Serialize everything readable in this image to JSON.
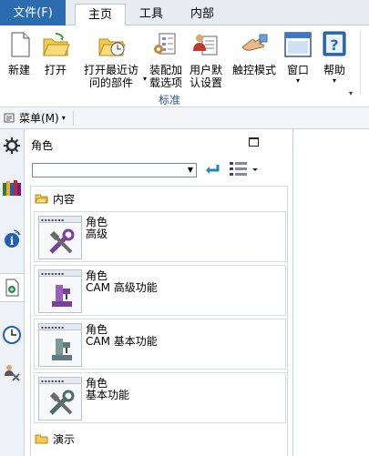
{
  "tabs": {
    "file": "文件(F)",
    "home": "主页",
    "tools": "工具",
    "internal": "内部"
  },
  "ribbon": {
    "buttons": {
      "new": "新建",
      "open": "打开",
      "open_recent_line1": "打开最近访",
      "open_recent_line2": "问的部件",
      "assembly_load_line1": "装配加",
      "assembly_load_line2": "载选项",
      "user_defaults_line1": "用户默",
      "user_defaults_line2": "认设置",
      "touch_mode": "触控模式",
      "window": "窗口",
      "help": "帮助"
    },
    "group_label": "标准"
  },
  "menubar": {
    "menu_label": "菜单(M)"
  },
  "panel": {
    "title": "角色",
    "combo_value": "",
    "content_folder": "内容",
    "demo_folder": "演示",
    "roles": [
      {
        "name": "角色",
        "desc": "高级",
        "icon": "tools-icon"
      },
      {
        "name": "角色",
        "desc": "CAM 高级功能",
        "icon": "cam-advanced-icon"
      },
      {
        "name": "角色",
        "desc": "CAM 基本功能",
        "icon": "cam-basic-icon"
      },
      {
        "name": "角色",
        "desc": "基本功能",
        "icon": "basic-tools-icon"
      }
    ]
  },
  "sidebar": {
    "icons": [
      "gear-icon",
      "books-icon",
      "info-icon",
      "document-icon",
      "clock-icon",
      "role-icon"
    ]
  }
}
